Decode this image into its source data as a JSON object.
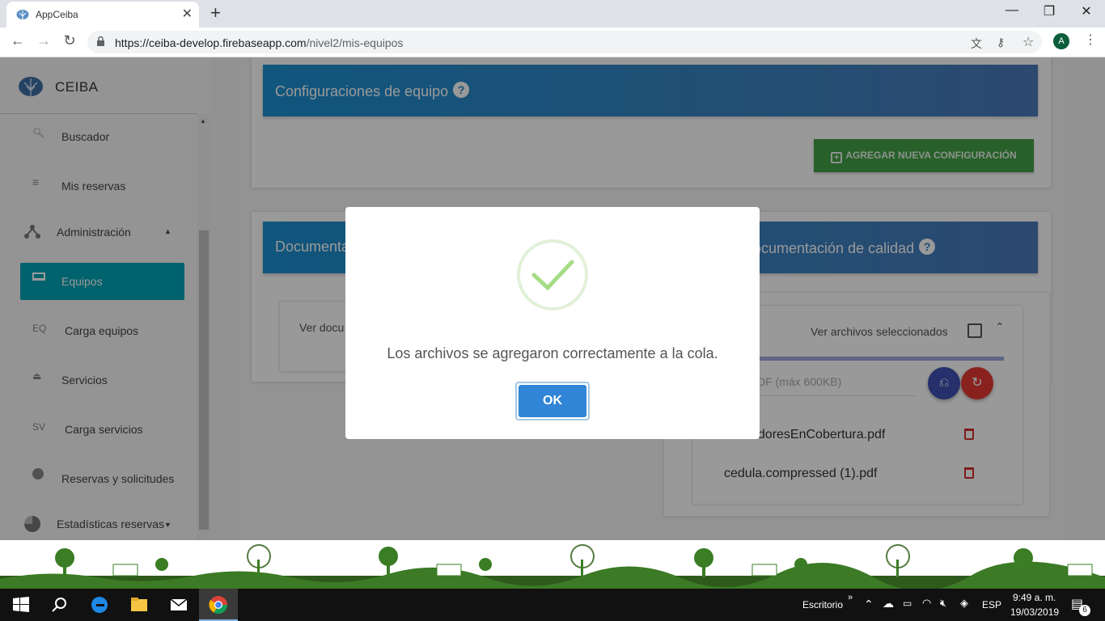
{
  "browser": {
    "tab_title": "AppCeiba",
    "url_host": "https://ceiba-develop.firebaseapp.com",
    "url_path": "/nivel2/mis-equipos",
    "avatar_letter": "A"
  },
  "sidebar": {
    "brand": "CEIBA",
    "items": [
      {
        "icon": "search-icon",
        "label": "Buscador"
      },
      {
        "icon": "list-icon",
        "label": "Mis reservas"
      },
      {
        "icon": "hierarchy-icon",
        "label": "Administración"
      },
      {
        "icon": "laptop-icon",
        "label": "Equipos"
      },
      {
        "icon": "EQ",
        "label": "Carga equipos"
      },
      {
        "icon": "eject-icon",
        "label": "Servicios"
      },
      {
        "icon": "SV",
        "label": "Carga servicios"
      },
      {
        "icon": "globe-icon",
        "label": "Reservas y solicitudes"
      },
      {
        "icon": "pie-icon",
        "label": "Estadísticas reservas"
      }
    ]
  },
  "main": {
    "config_title": "Configuraciones de equipo",
    "add_config_label": "AGREGAR NUEVA CONFIGURACIÓN",
    "docs_title_left": "Documenta",
    "docs_title_right": "ocumentación de calidad",
    "ver_docs_left": "Ver docu",
    "ver_archivos": "Ver archivos seleccionados",
    "pdf_hint": "DF (máx 600KB)",
    "files": [
      "adoresEnCobertura.pdf",
      "cedula.compressed (1).pdf"
    ]
  },
  "dialog": {
    "message": "Los archivos se agregaron correctamente a la cola.",
    "ok_label": "OK",
    "accent": "#3085d6",
    "success_color": "#a5dc86"
  },
  "taskbar": {
    "desktop_label": "Escritorio",
    "lang": "ESP",
    "time": "9:49 a. m.",
    "date": "19/03/2019",
    "notif_count": "6"
  }
}
